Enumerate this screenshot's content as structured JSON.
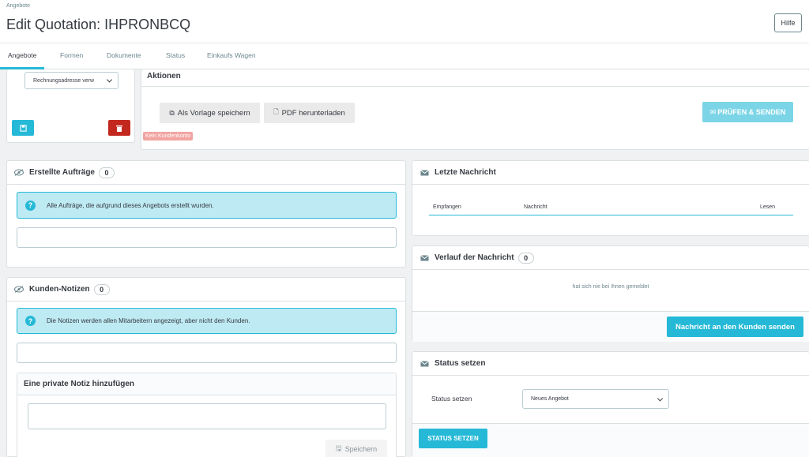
{
  "header": {
    "breadcrumb": "Angebote",
    "title": "Edit Quotation: IHPRONBCQ",
    "help_label": "Hilfe"
  },
  "tabs": [
    "Angebote",
    "Formen",
    "Dokumente",
    "Status",
    "Einkaufs Wagen"
  ],
  "address": {
    "select_value": "Rechnungsadresse verw"
  },
  "actions": {
    "title": "Aktionen",
    "save_template_label": "Als Vorlage speichern",
    "pdf_label": "PDF herunterladen",
    "check_send_label": "PRÜFEN & SENDEN",
    "no_account_label": "Kein Kundenkonto"
  },
  "orders": {
    "title": "Erstellte Aufträge",
    "count": "0",
    "info": "Alle Aufträge, die aufgrund dieses Angebots erstellt wurden."
  },
  "notes": {
    "title": "Kunden-Notizen",
    "count": "0",
    "info": "Die Notizen werden allen Mitarbeitern angezeigt, aber nicht den Kunden.",
    "private_title": "Eine private Notiz hinzufügen",
    "save_label": "Speichern"
  },
  "last_message": {
    "title": "Letzte Nachricht",
    "columns": [
      "Empfangen",
      "Nachricht",
      "Lesen"
    ]
  },
  "history": {
    "title": "Verlauf der Nachricht",
    "count": "0",
    "empty": "hat sich nie bei Ihnen gemeldet",
    "send_label": "Nachricht an den Kunden senden"
  },
  "status": {
    "title": "Status setzen",
    "field_label": "Status setzen",
    "select_value": "Neues Angebot",
    "button_label": "STATUS SETZEN"
  },
  "colors": {
    "accent": "#25b9d7",
    "danger": "#c3281f",
    "info_bg": "#beeaf3"
  }
}
